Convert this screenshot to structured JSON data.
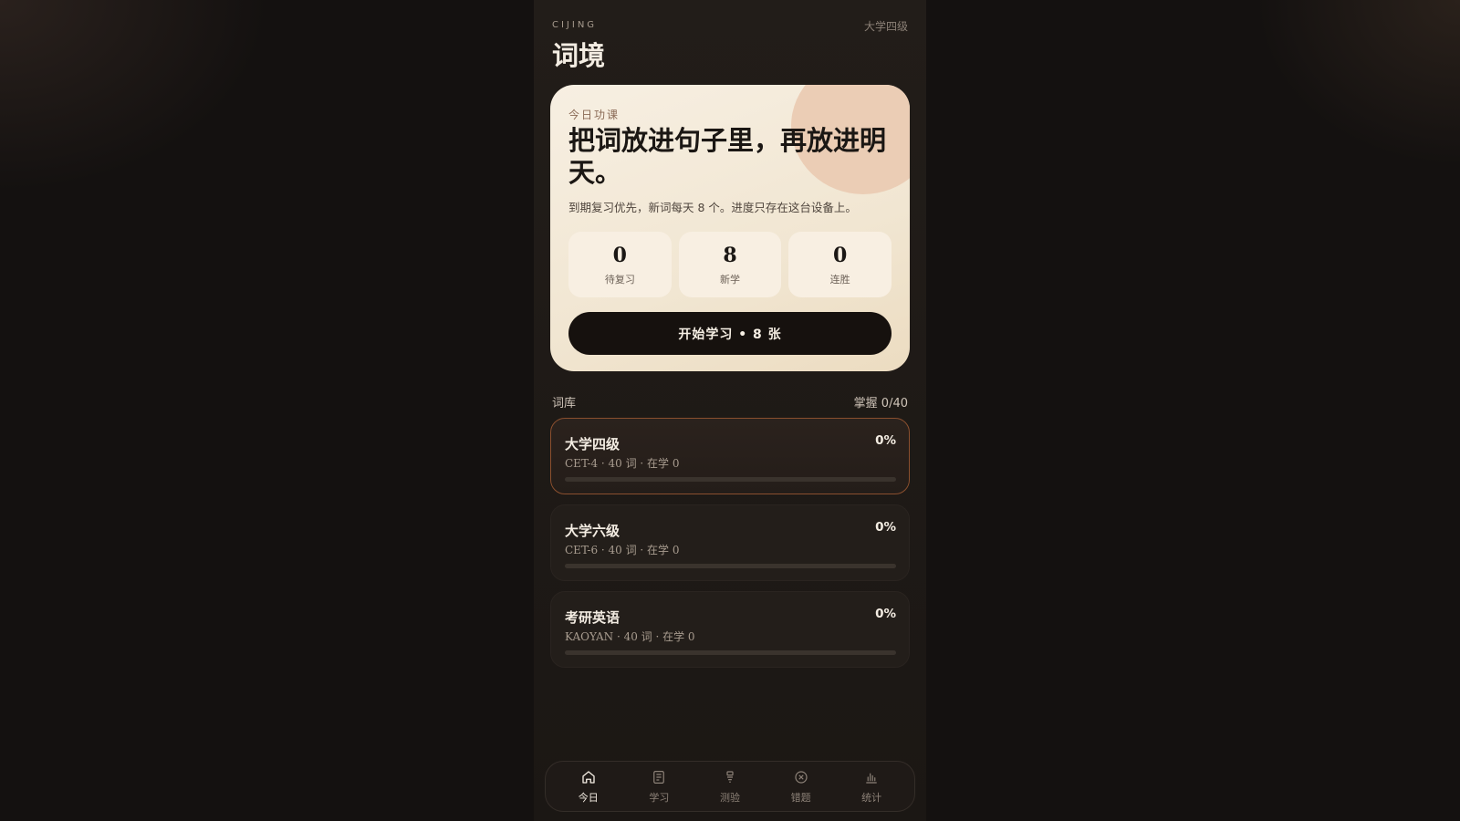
{
  "header": {
    "brand_en": "CIJING",
    "title": "词境",
    "current_level": "大学四级"
  },
  "hero": {
    "kicker": "今日功课",
    "title": "把词放进句子里，再放进明天。",
    "subtitle": "到期复习优先，新词每天 8 个。进度只存在这台设备上。",
    "stats": [
      {
        "value": "0",
        "label": "待复习"
      },
      {
        "value": "8",
        "label": "新学"
      },
      {
        "value": "0",
        "label": "连胜"
      }
    ],
    "start_button": "开始学习 • 8 张"
  },
  "library": {
    "title": "词库",
    "mastery": "掌握 0/40",
    "decks": [
      {
        "name": "大学四级",
        "meta": "CET-4 · 40 词 · 在学 0",
        "percent": "0%",
        "progress": 0,
        "active": true
      },
      {
        "name": "大学六级",
        "meta": "CET-6 · 40 词 · 在学 0",
        "percent": "0%",
        "progress": 0,
        "active": false
      },
      {
        "name": "考研英语",
        "meta": "KAOYAN · 40 词 · 在学 0",
        "percent": "0%",
        "progress": 0,
        "active": false
      }
    ]
  },
  "tabbar": {
    "tabs": [
      {
        "label": "今日",
        "icon": "home-icon",
        "active": true
      },
      {
        "label": "学习",
        "icon": "document-icon",
        "active": false
      },
      {
        "label": "测验",
        "icon": "quiz-icon",
        "active": false
      },
      {
        "label": "错题",
        "icon": "x-circle-icon",
        "active": false
      },
      {
        "label": "统计",
        "icon": "bar-chart-icon",
        "active": false
      }
    ]
  }
}
